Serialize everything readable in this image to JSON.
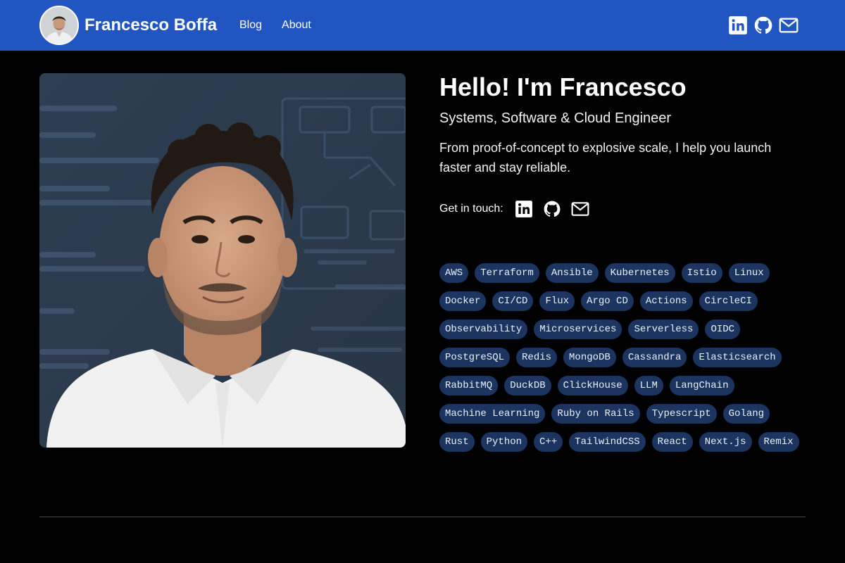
{
  "header": {
    "site_name": "Francesco Boffa",
    "nav": [
      {
        "label": "Blog"
      },
      {
        "label": "About"
      }
    ],
    "social_icons": [
      "linkedin-icon",
      "github-icon",
      "mail-icon"
    ],
    "background_color": "#2155c2"
  },
  "hero": {
    "title": "Hello! I'm Francesco",
    "subtitle": "Systems, Software & Cloud Engineer",
    "description": "From proof-of-concept to explosive scale, I help you launch faster and stay reliable.",
    "contact_label": "Get in touch:",
    "contact_icons": [
      "linkedin-icon",
      "github-icon",
      "mail-icon"
    ]
  },
  "skills": [
    "AWS",
    "Terraform",
    "Ansible",
    "Kubernetes",
    "Istio",
    "Linux",
    "Docker",
    "CI/CD",
    "Flux",
    "Argo CD",
    "Actions",
    "CircleCI",
    "Observability",
    "Microservices",
    "Serverless",
    "OIDC",
    "PostgreSQL",
    "Redis",
    "MongoDB",
    "Cassandra",
    "Elasticsearch",
    "RabbitMQ",
    "DuckDB",
    "ClickHouse",
    "LLM",
    "LangChain",
    "Machine Learning",
    "Ruby on Rails",
    "Typescript",
    "Golang",
    "Rust",
    "Python",
    "C++",
    "TailwindCSS",
    "React",
    "Next.js",
    "Remix"
  ],
  "colors": {
    "page_background": "#000000",
    "tag_background": "#1c3560",
    "tag_text": "#eaf0fb",
    "divider": "#4a4a4a"
  }
}
